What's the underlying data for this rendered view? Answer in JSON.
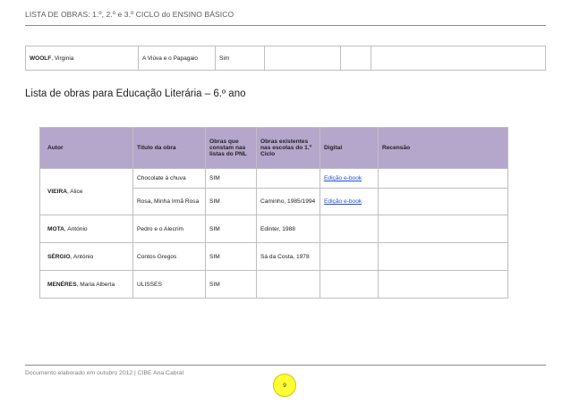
{
  "header": {
    "title": "LISTA DE OBRAS: 1.º, 2.º e 3.º CICLO do ENSINO BÁSICO"
  },
  "top_table": {
    "author_surname": "WOOLF",
    "author_given": ", Virginia",
    "title": "A Viúva e o Papagaio",
    "pnl": "Sim"
  },
  "section": {
    "title": "Lista de obras para Educação Literária – 6.º ano"
  },
  "main_table": {
    "headers": {
      "autor": "Autor",
      "titulo": "Título da obra",
      "pnl": "Obras que constam nas listas do PNL",
      "existentes": "Obras existentes nas escolas do 1.º Ciclo",
      "digital": "Digital",
      "recensao": "Recensão"
    },
    "rows": [
      {
        "surname": "VIEIRA",
        "given": ", Alice",
        "title": "Chocolate à chuva",
        "pnl": "SIM",
        "existing": "",
        "digital": "Edição e-book"
      },
      {
        "title": "Rosa, Minha Irmã Rosa",
        "pnl": "SIM",
        "existing": "Caminho, 1985/1994",
        "digital": "Edição e-book"
      },
      {
        "surname": "MOTA",
        "given": ", António",
        "title": "Pedro e o Alecrim",
        "pnl": "SIM",
        "existing": "Edinter, 1988",
        "digital": ""
      },
      {
        "surname": "SÉRGIO",
        "given": ", António",
        "title": "Contos Gregos",
        "pnl": "SIM",
        "existing": "Sá da Costa, 1978",
        "digital": ""
      },
      {
        "surname": "MENÉRES",
        "given": ", Maria Alberta",
        "title": "ULISSES",
        "pnl": "SIM",
        "existing": "",
        "digital": ""
      }
    ]
  },
  "footer": {
    "text": "Documento elaborado em outubro 2012 | CIBE Ana Cabral",
    "page": "9"
  },
  "colors": {
    "header_bg": "#b5a6cc",
    "link": "#1f4fd8",
    "badge": "#ffff33"
  }
}
